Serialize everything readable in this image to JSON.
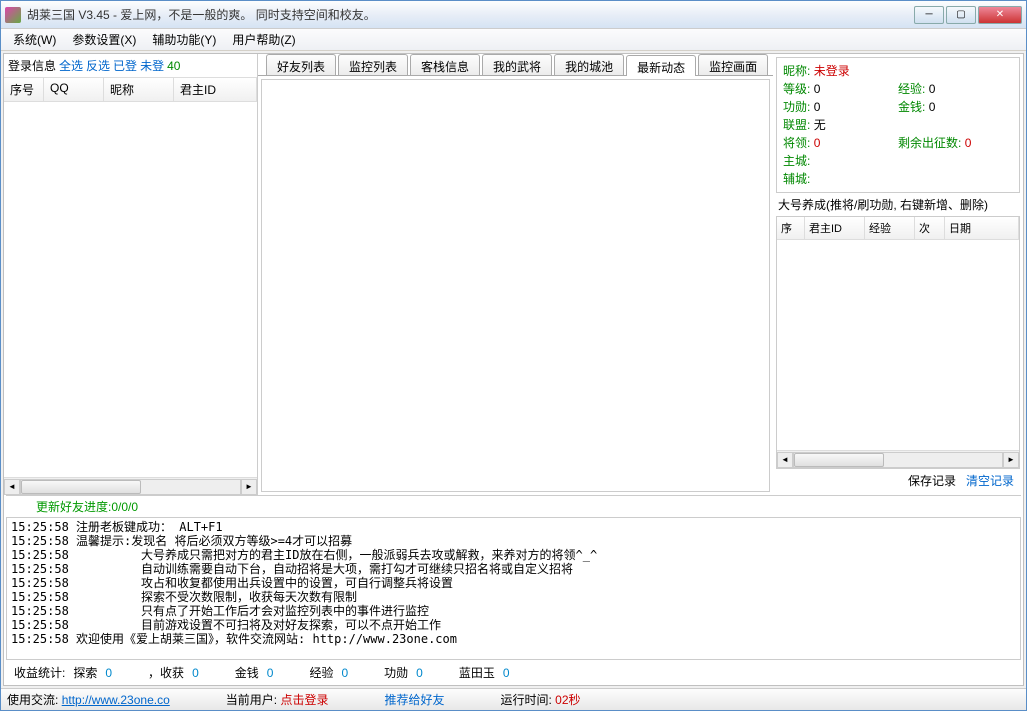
{
  "window": {
    "title": "胡莱三国 V3.45 - 爱上网，不是一般的爽。  同时支持空间和校友。"
  },
  "menu": {
    "system": "系统(W)",
    "params": "参数设置(X)",
    "aux": "辅助功能(Y)",
    "help": "用户帮助(Z)"
  },
  "left": {
    "login_info": "登录信息",
    "select_all": "全选",
    "invert": "反选",
    "logged": "已登",
    "not_logged": "未登",
    "count": "40",
    "cols": {
      "seq": "序号",
      "qq": "QQ",
      "nick": "昵称",
      "lord": "君主ID"
    }
  },
  "tabs": {
    "friends": "好友列表",
    "monitor": "监控列表",
    "inn": "客栈信息",
    "generals": "我的武将",
    "cities": "我的城池",
    "latest": "最新动态",
    "screen": "监控画面"
  },
  "right": {
    "nick_label": "昵称:",
    "nick_val": "未登录",
    "level_label": "等级:",
    "level_val": "0",
    "exp_label": "经验:",
    "exp_val": "0",
    "merit_label": "功勋:",
    "merit_val": "0",
    "money_label": "金钱:",
    "money_val": "0",
    "alliance_label": "联盟:",
    "alliance_val": "无",
    "gen_label": "将领:",
    "gen_val": "0",
    "expedition_label": "剩余出征数:",
    "expedition_val": "0",
    "main_city_label": "主城:",
    "sub_city_label": "辅城:",
    "sub_title": "大号养成(推将/刷功勋, 右键新增、删除)",
    "cols": {
      "seq": "序",
      "lord": "君主ID",
      "exp": "经验",
      "times": "次",
      "date": "日期"
    },
    "save": "保存记录",
    "clear": "清空记录"
  },
  "log": {
    "header": "更新好友进度:0/0/0",
    "lines": [
      "15:25:58 注册老板键成功： ALT+F1",
      "15:25:58 温馨提示:发现名 将后必须双方等级>=4才可以招募",
      "15:25:58          大号养成只需把对方的君主ID放在右侧，一般派弱兵去攻或解救，来养对方的将领^_^",
      "15:25:58          自动训练需要自动下台，自动招将是大项，需打勾才可继续只招名将或自定义招将",
      "15:25:58          攻占和收复都使用出兵设置中的设置，可自行调整兵将设置",
      "15:25:58          探索不受次数限制，收获每天次数有限制",
      "15:25:58          只有点了开始工作后才会对监控列表中的事件进行监控",
      "15:25:58          目前游戏设置不可扫将及对好友探索，可以不点开始工作",
      "15:25:58 欢迎使用《爱上胡莱三国》，软件交流网站: http://www.23one.com"
    ]
  },
  "stats": {
    "label": "收益统计:",
    "explore": "探索",
    "explore_val": "0",
    "harvest": "，收获",
    "harvest_val": "0",
    "money": "金钱",
    "money_val": "0",
    "exp": "经验",
    "exp_val": "0",
    "merit": "功勋",
    "merit_val": "0",
    "jade": "蓝田玉",
    "jade_val": "0"
  },
  "status": {
    "contact": "使用交流:",
    "url": "http://www.23one.co",
    "current_user": "当前用户:",
    "click_login": "点击登录",
    "recommend": "推荐给好友",
    "runtime_label": "运行时间:",
    "runtime_val": "02秒"
  }
}
